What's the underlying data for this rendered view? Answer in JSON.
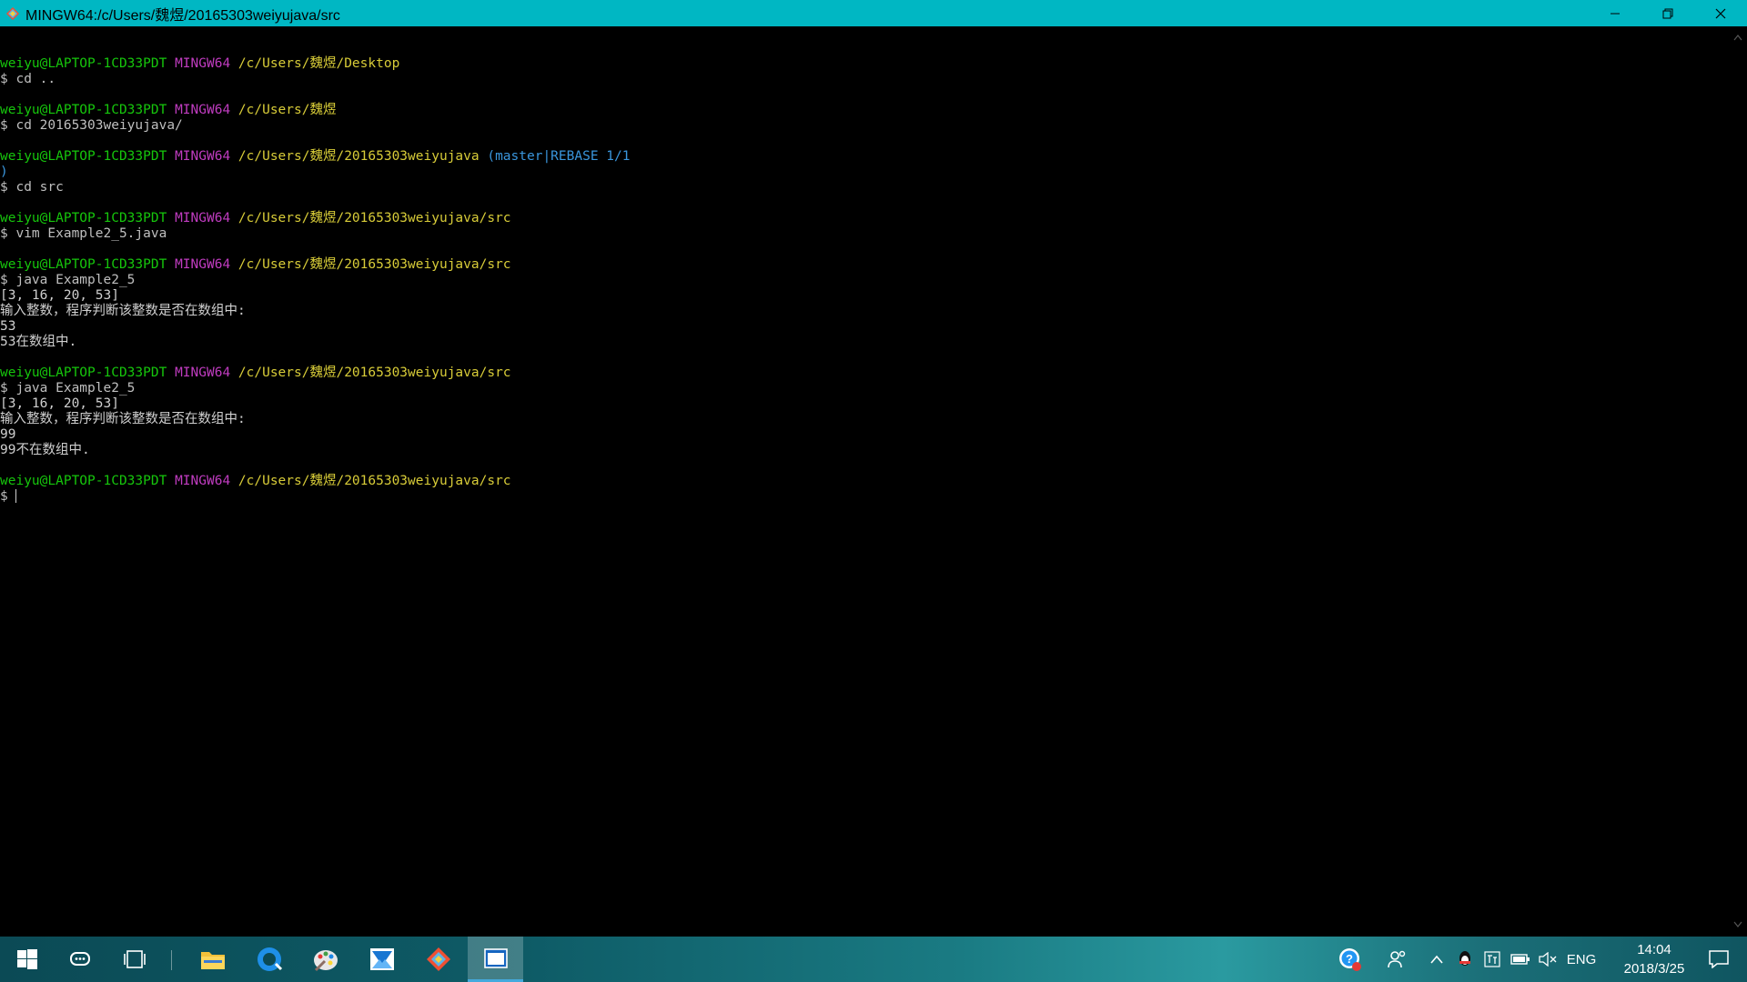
{
  "window": {
    "title": "MINGW64:/c/Users/魏煜/20165303weiyujava/src",
    "minimize_glyph": "—",
    "restore_glyph": "❐",
    "close_glyph": "✕"
  },
  "terminal": {
    "lines": [
      {
        "segments": []
      },
      {
        "segments": [
          {
            "text": "weiyu@LAPTOP-1CD33PDT",
            "role": "user"
          },
          {
            "text": " "
          },
          {
            "text": "MINGW64",
            "role": "host"
          },
          {
            "text": " "
          },
          {
            "text": "/c/Users/魏煜/Desktop",
            "role": "path"
          }
        ]
      },
      {
        "segments": [
          {
            "text": "$ cd .."
          }
        ]
      },
      {
        "segments": []
      },
      {
        "segments": [
          {
            "text": "weiyu@LAPTOP-1CD33PDT",
            "role": "user"
          },
          {
            "text": " "
          },
          {
            "text": "MINGW64",
            "role": "host"
          },
          {
            "text": " "
          },
          {
            "text": "/c/Users/魏煜",
            "role": "path"
          }
        ]
      },
      {
        "segments": [
          {
            "text": "$ cd 20165303weiyujava/"
          }
        ]
      },
      {
        "segments": []
      },
      {
        "segments": [
          {
            "text": "weiyu@LAPTOP-1CD33PDT",
            "role": "user"
          },
          {
            "text": " "
          },
          {
            "text": "MINGW64",
            "role": "host"
          },
          {
            "text": " "
          },
          {
            "text": "/c/Users/魏煜/20165303weiyujava",
            "role": "path"
          },
          {
            "text": " "
          },
          {
            "text": "(master|REBASE 1/1",
            "role": "git"
          }
        ]
      },
      {
        "segments": [
          {
            "text": ")",
            "role": "git"
          }
        ]
      },
      {
        "segments": [
          {
            "text": "$ cd src"
          }
        ]
      },
      {
        "segments": []
      },
      {
        "segments": [
          {
            "text": "weiyu@LAPTOP-1CD33PDT",
            "role": "user"
          },
          {
            "text": " "
          },
          {
            "text": "MINGW64",
            "role": "host"
          },
          {
            "text": " "
          },
          {
            "text": "/c/Users/魏煜/20165303weiyujava/src",
            "role": "path"
          }
        ]
      },
      {
        "segments": [
          {
            "text": "$ vim Example2_5.java"
          }
        ]
      },
      {
        "segments": []
      },
      {
        "segments": [
          {
            "text": "weiyu@LAPTOP-1CD33PDT",
            "role": "user"
          },
          {
            "text": " "
          },
          {
            "text": "MINGW64",
            "role": "host"
          },
          {
            "text": " "
          },
          {
            "text": "/c/Users/魏煜/20165303weiyujava/src",
            "role": "path"
          }
        ]
      },
      {
        "segments": [
          {
            "text": "$ java Example2_5"
          }
        ]
      },
      {
        "segments": [
          {
            "text": "[3, 16, 20, 53]",
            "role": "out"
          }
        ]
      },
      {
        "segments": [
          {
            "text": "输入整数，程序判断该整数是否在数组中:",
            "role": "out"
          }
        ]
      },
      {
        "segments": [
          {
            "text": "53",
            "role": "out"
          }
        ]
      },
      {
        "segments": [
          {
            "text": "53在数组中.",
            "role": "out"
          }
        ]
      },
      {
        "segments": []
      },
      {
        "segments": [
          {
            "text": "weiyu@LAPTOP-1CD33PDT",
            "role": "user"
          },
          {
            "text": " "
          },
          {
            "text": "MINGW64",
            "role": "host"
          },
          {
            "text": " "
          },
          {
            "text": "/c/Users/魏煜/20165303weiyujava/src",
            "role": "path"
          }
        ]
      },
      {
        "segments": [
          {
            "text": "$ java Example2_5"
          }
        ]
      },
      {
        "segments": [
          {
            "text": "[3, 16, 20, 53]",
            "role": "out"
          }
        ]
      },
      {
        "segments": [
          {
            "text": "输入整数，程序判断该整数是否在数组中:",
            "role": "out"
          }
        ]
      },
      {
        "segments": [
          {
            "text": "99",
            "role": "out"
          }
        ]
      },
      {
        "segments": [
          {
            "text": "99不在数组中.",
            "role": "out"
          }
        ]
      },
      {
        "segments": []
      },
      {
        "segments": [
          {
            "text": "weiyu@LAPTOP-1CD33PDT",
            "role": "user"
          },
          {
            "text": " "
          },
          {
            "text": "MINGW64",
            "role": "host"
          },
          {
            "text": " "
          },
          {
            "text": "/c/Users/魏煜/20165303weiyujava/src",
            "role": "path"
          }
        ]
      },
      {
        "segments": [
          {
            "text": "$ "
          }
        ],
        "cursor": true
      }
    ]
  },
  "taskbar": {
    "items": [
      {
        "name": "start-button",
        "icon": "windows-logo-icon"
      },
      {
        "name": "cortana-button",
        "icon": "chat-icon"
      },
      {
        "name": "task-view-button",
        "icon": "task-view-icon"
      },
      {
        "name": "file-explorer-button",
        "icon": "folder-icon"
      },
      {
        "name": "browser-button",
        "icon": "browser-icon"
      },
      {
        "name": "paint-button",
        "icon": "palette-icon"
      },
      {
        "name": "mail-button",
        "icon": "mail-icon"
      },
      {
        "name": "git-button",
        "icon": "git-icon"
      },
      {
        "name": "terminal-button",
        "icon": "terminal-icon",
        "active": true
      }
    ],
    "tray": {
      "language": "ENG",
      "time": "14:04",
      "date": "2018/3/25"
    }
  },
  "colors": {
    "titlebar": "#00b7c3",
    "prompt_user": "#16c60c",
    "prompt_host": "#c03cc0",
    "prompt_path": "#d8cc38",
    "git_branch": "#3a96dd"
  }
}
